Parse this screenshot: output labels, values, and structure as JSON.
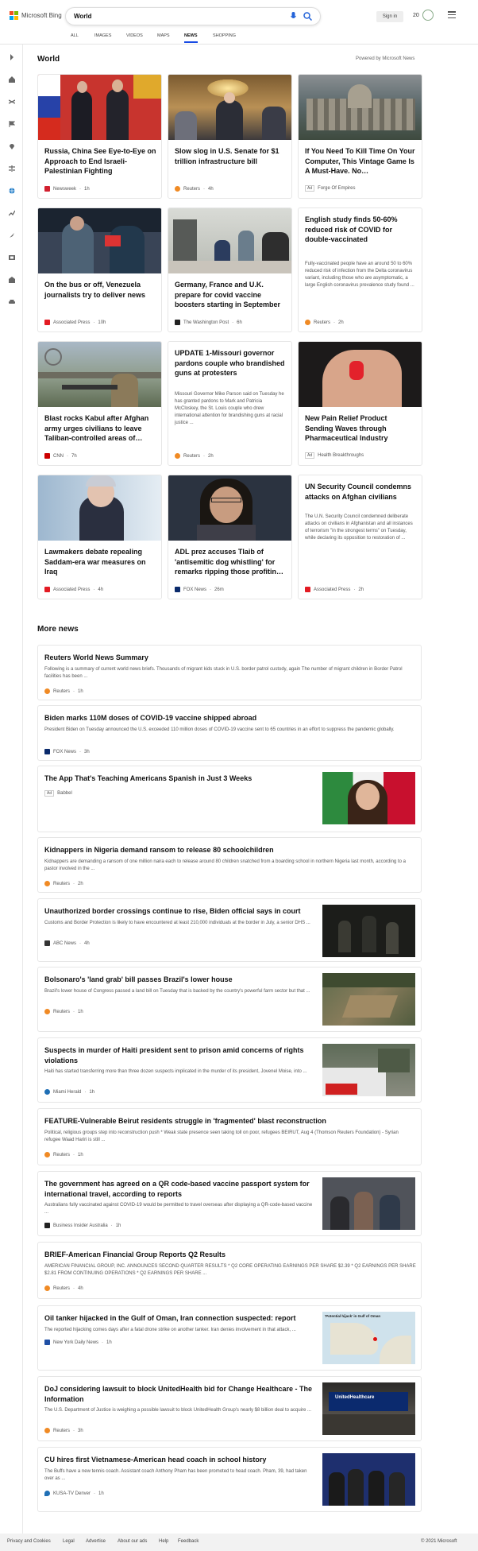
{
  "header": {
    "brand": "Microsoft Bing",
    "query": "World",
    "signin": "Sign in",
    "points": "20",
    "logo_colors": [
      "#f25022",
      "#7fba00",
      "#00a4ef",
      "#ffb900"
    ]
  },
  "tabs": [
    {
      "label": "ALL"
    },
    {
      "label": "IMAGES"
    },
    {
      "label": "VIDEOS"
    },
    {
      "label": "MAPS"
    },
    {
      "label": "NEWS",
      "active": true
    },
    {
      "label": "SHOPPING"
    }
  ],
  "rail_icons": [
    "chevron-right-icon",
    "home-icon",
    "shuffle-icon",
    "flag-icon",
    "map-pin-icon",
    "scale-icon",
    "globe-icon",
    "trending-icon",
    "rocket-icon",
    "film-icon",
    "building-icon",
    "car-icon"
  ],
  "section": {
    "title": "World",
    "powered": "Powered by Microsoft News"
  },
  "cards": [
    {
      "title": "Russia, China See Eye-to-Eye on Approach to End Israeli-Palestinian Fighting",
      "source": "Newsweek",
      "time": "1h",
      "badge": "#d2202f"
    },
    {
      "title": "Slow slog in U.S. Senate for $1 trillion infrastructure bill",
      "source": "Reuters",
      "time": "4h",
      "badge": "#f08a24"
    },
    {
      "title": "If You Need To Kill Time On Your Computer, This Vintage Game Is A Must-Have. No…",
      "ad": "Ad",
      "source": "Forge Of Empires"
    },
    {
      "title": "On the bus or off, Venezuela journalists try to deliver news",
      "source": "Associated Press",
      "time": "10h",
      "badge": "#e31b23"
    },
    {
      "title": "Germany, France and U.K. prepare for covid vaccine boosters starting in September",
      "source": "The Washington Post",
      "time": "6h",
      "badge": "#222"
    },
    {
      "title": "English study finds 50-60% reduced risk of COVID for double-vaccinated",
      "snippet": "Fully-vaccinated people have an around 50 to 60% reduced risk of infection from the Delta coronavirus variant, including those who are asymptomatic, a large English coronavirus prevalence study found ...",
      "source": "Reuters",
      "time": "2h",
      "badge": "#f08a24"
    },
    {
      "title": "Blast rocks Kabul after Afghan army urges civilians to leave Taliban-controlled areas of…",
      "source": "CNN",
      "time": "7h",
      "badge": "#cc0000"
    },
    {
      "title": "UPDATE 1-Missouri governor pardons couple who brandished guns at protesters",
      "snippet": "Missouri Governor Mike Parson said on Tuesday he has granted pardons to Mark and Patricia McCloskey, the St. Louis couple who drew international attention for brandishing guns at racial justice ...",
      "source": "Reuters",
      "time": "2h",
      "badge": "#f08a24"
    },
    {
      "title": "New Pain Relief Product Sending Waves through Pharmaceutical Industry",
      "ad": "Ad",
      "source": "Health Breakthroughs"
    },
    {
      "title": "Lawmakers debate repealing Saddam-era war measures on Iraq",
      "source": "Associated Press",
      "time": "4h",
      "badge": "#e31b23"
    },
    {
      "title": "ADL prez accuses Tlaib of 'antisemitic dog whistling' for remarks ripping those profitin…",
      "source": "FOX News",
      "time": "26m",
      "badge": "#0a2a6b"
    },
    {
      "title": "UN Security Council condemns attacks on Afghan civilians",
      "snippet": "The U.N. Security Council condemned deliberate attacks on civilians in Afghanistan and all instances of terrorism \"in the strongest terms\" on Tuesday, while declaring its opposition to restoration of ...",
      "source": "Associated Press",
      "time": "2h",
      "badge": "#e31b23"
    }
  ],
  "more_title": "More news",
  "more": [
    {
      "title": "Reuters World News Summary",
      "snippet": "Following is a summary of current world news briefs. Thousands of migrant kids stuck in U.S. border patrol custody, again The number of migrant children in Border Patrol facilities has been ...",
      "source": "Reuters",
      "time": "1h",
      "badge": "#f08a24"
    },
    {
      "title": "Biden marks 110M doses of COVID-19 vaccine shipped abroad",
      "snippet": "President Biden on Tuesday announced the U.S. exceeded 110 million doses of COVID-19 vaccine sent to 65 countries in an effort to suppress the pandemic globally.",
      "source": "FOX News",
      "time": "3h",
      "badge": "#0a2a6b"
    },
    {
      "title": "The App That's Teaching Americans Spanish in Just 3 Weeks",
      "ad": "Ad",
      "source": "Babbel"
    },
    {
      "title": "Kidnappers in Nigeria demand ransom to release 80 schoolchildren",
      "snippet": "Kidnappers are demanding a ransom of one million naira each to release around 80 children snatched from a boarding school in northern Nigeria last month, according to a pastor involved in the ...",
      "source": "Reuters",
      "time": "2h",
      "badge": "#f08a24"
    },
    {
      "title": "Unauthorized border crossings continue to rise, Biden official says in court",
      "snippet": "Customs and Border Protection is likely to have encountered at least 210,000 individuals at the border in July, a senior DHS ...",
      "source": "ABC News",
      "time": "4h",
      "badge": "#333"
    },
    {
      "title": "Bolsonaro's 'land grab' bill passes Brazil's lower house",
      "snippet": "Brazil's lower house of Congress passed a land bill on Tuesday that is backed by the country's powerful farm sector but that ...",
      "source": "Reuters",
      "time": "1h",
      "badge": "#f08a24"
    },
    {
      "title": "Suspects in murder of Haiti president sent to prison amid concerns of rights violations",
      "snippet": "Haiti has started transferring more than three dozen suspects implicated in the murder of its president, Jovenel Moise, into ...",
      "source": "Miami Herald",
      "time": "1h",
      "badge": "#1f6fb5"
    },
    {
      "title": "FEATURE-Vulnerable Beirut residents struggle in 'fragmented' blast reconstruction",
      "snippet": "Political, religious groups step into reconstruction push * Weak state presence seen taking toll on poor, refugees BEIRUT, Aug 4 (Thomson Reuters Foundation) - Syrian refugee Waad Hariri is still ...",
      "source": "Reuters",
      "time": "1h",
      "badge": "#f08a24"
    },
    {
      "title": "The government has agreed on a QR code-based vaccine passport system for international travel, according to reports",
      "snippet": "Australians fully vaccinated against COVID-19 would be permitted to travel overseas after displaying a QR-code-based vaccine ...",
      "source": "Business Insider Australia",
      "time": "1h",
      "badge": "#222"
    },
    {
      "title": "BRIEF-American Financial Group Reports Q2 Results",
      "snippet": "AMERICAN FINANCIAL GROUP, INC. ANNOUNCES SECOND QUARTER RESULTS * Q2 CORE OPERATING EARNINGS PER SHARE $2.39 * Q2 EARNINGS PER SHARE $2.81 FROM CONTINUING OPERATIONS * Q2 EARNINGS PER SHARE ...",
      "source": "Reuters",
      "time": "4h",
      "badge": "#f08a24"
    },
    {
      "title": "Oil tanker hijacked in the Gulf of Oman, Iran connection suspected: report",
      "snippet": "The reported hijacking comes days after a fatal drone strike on another tanker. Iran denies involvement in that attack, ...",
      "source": "New York Daily News",
      "time": "1h",
      "badge": "#1f4fa5",
      "thumb_caption": "'Potential hijack' in Gulf of Oman"
    },
    {
      "title": "DoJ considering lawsuit to block UnitedHealth bid for Change Healthcare - The Information",
      "snippet": "The U.S. Department of Justice is weighing a possible lawsuit to block UnitedHealth Group's nearly $8 billion deal to acquire ...",
      "source": "Reuters",
      "time": "3h",
      "badge": "#f08a24",
      "thumb_caption": "UnitedHealthcare"
    },
    {
      "title": "CU hires first Vietnamese-American head coach in school history",
      "snippet": "The Buffs have a new tennis coach. Assistant coach Anthony Pham has been promoted to head coach. Pham, 39, had taken over as ...",
      "source": "KUSA-TV Denver",
      "time": "1h",
      "badge": "#1f6fb5"
    }
  ],
  "footer": {
    "links": [
      "Privacy and Cookies",
      "Legal",
      "Advertise",
      "About our ads",
      "Help",
      "Feedback"
    ],
    "copyright": "© 2021 Microsoft"
  }
}
